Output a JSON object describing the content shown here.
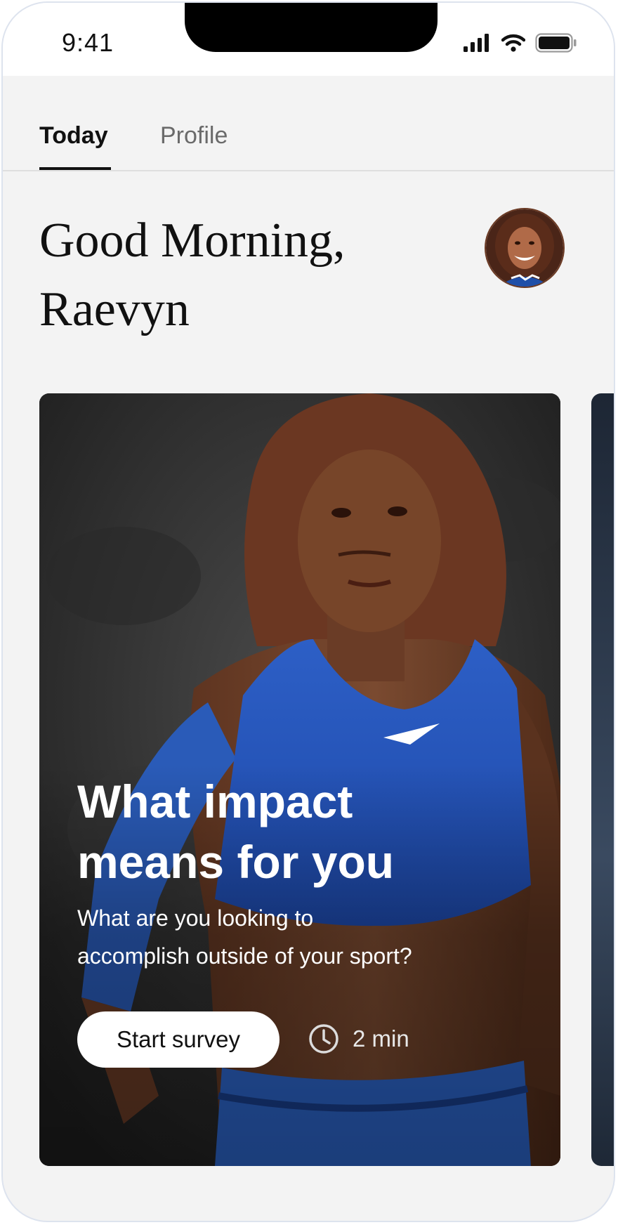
{
  "status_bar": {
    "time": "9:41"
  },
  "tabs": [
    {
      "label": "Today",
      "active": true
    },
    {
      "label": "Profile",
      "active": false
    }
  ],
  "greeting": {
    "line1": "Good Morning,",
    "line2": "Raevyn"
  },
  "card": {
    "title_line1": "What impact",
    "title_line2": "means for you",
    "subtitle_line1": "What are you looking to",
    "subtitle_line2": "accomplish outside of your sport?",
    "button_label": "Start survey",
    "duration": "2 min",
    "duration_icon": "clock-icon"
  },
  "colors": {
    "background": "#f3f3f3",
    "text": "#111111",
    "tab_inactive": "#6a6a6a",
    "button_bg": "#ffffff"
  }
}
